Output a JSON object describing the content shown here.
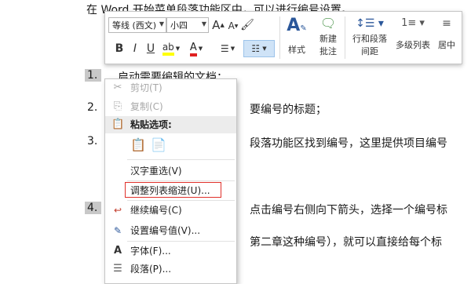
{
  "document": {
    "line0": "在 Word 开始菜单段落功能区中，可以进行编号设置。",
    "items": [
      {
        "num": "1.",
        "text": "启动需要编辑的文档；"
      },
      {
        "num": "2.",
        "text": "要编号的标题；"
      },
      {
        "num": "3.",
        "text": "段落功能区找到编号，这里提供项目编号"
      },
      {
        "num": "4.",
        "text": "点击编号右侧向下箭头，选择一个编号标"
      },
      {
        "num": "",
        "text": "第二章这种编号），就可以直接给每个标"
      }
    ]
  },
  "toolbar": {
    "font_name": "等线 (西文)",
    "font_size": "小四",
    "grow_font": "A",
    "shrink_font": "A",
    "bold": "B",
    "italic": "I",
    "underline": "U",
    "styles_label": "样式",
    "new_comment_label_1": "新建",
    "new_comment_label_2": "批注",
    "line_spacing_label_1": "行和段落",
    "line_spacing_label_2": "间距",
    "multilevel_label": "多级列表",
    "center_label": "居中",
    "highlight_color": "#ffff00",
    "font_color": "#e02020"
  },
  "context_menu": {
    "cut": "剪切(T)",
    "copy": "复制(C)",
    "paste_options": "粘贴选项:",
    "hanzi_reselect": "汉字重选(V)",
    "adjust_list_indent": "调整列表缩进(U)...",
    "continue_numbering": "继续编号(C)",
    "set_number_value": "设置编号值(V)...",
    "font": "字体(F)...",
    "paragraph": "段落(P)..."
  },
  "colors": {
    "highlight_box": "#e0302a",
    "selection": "#c8c8c8"
  }
}
